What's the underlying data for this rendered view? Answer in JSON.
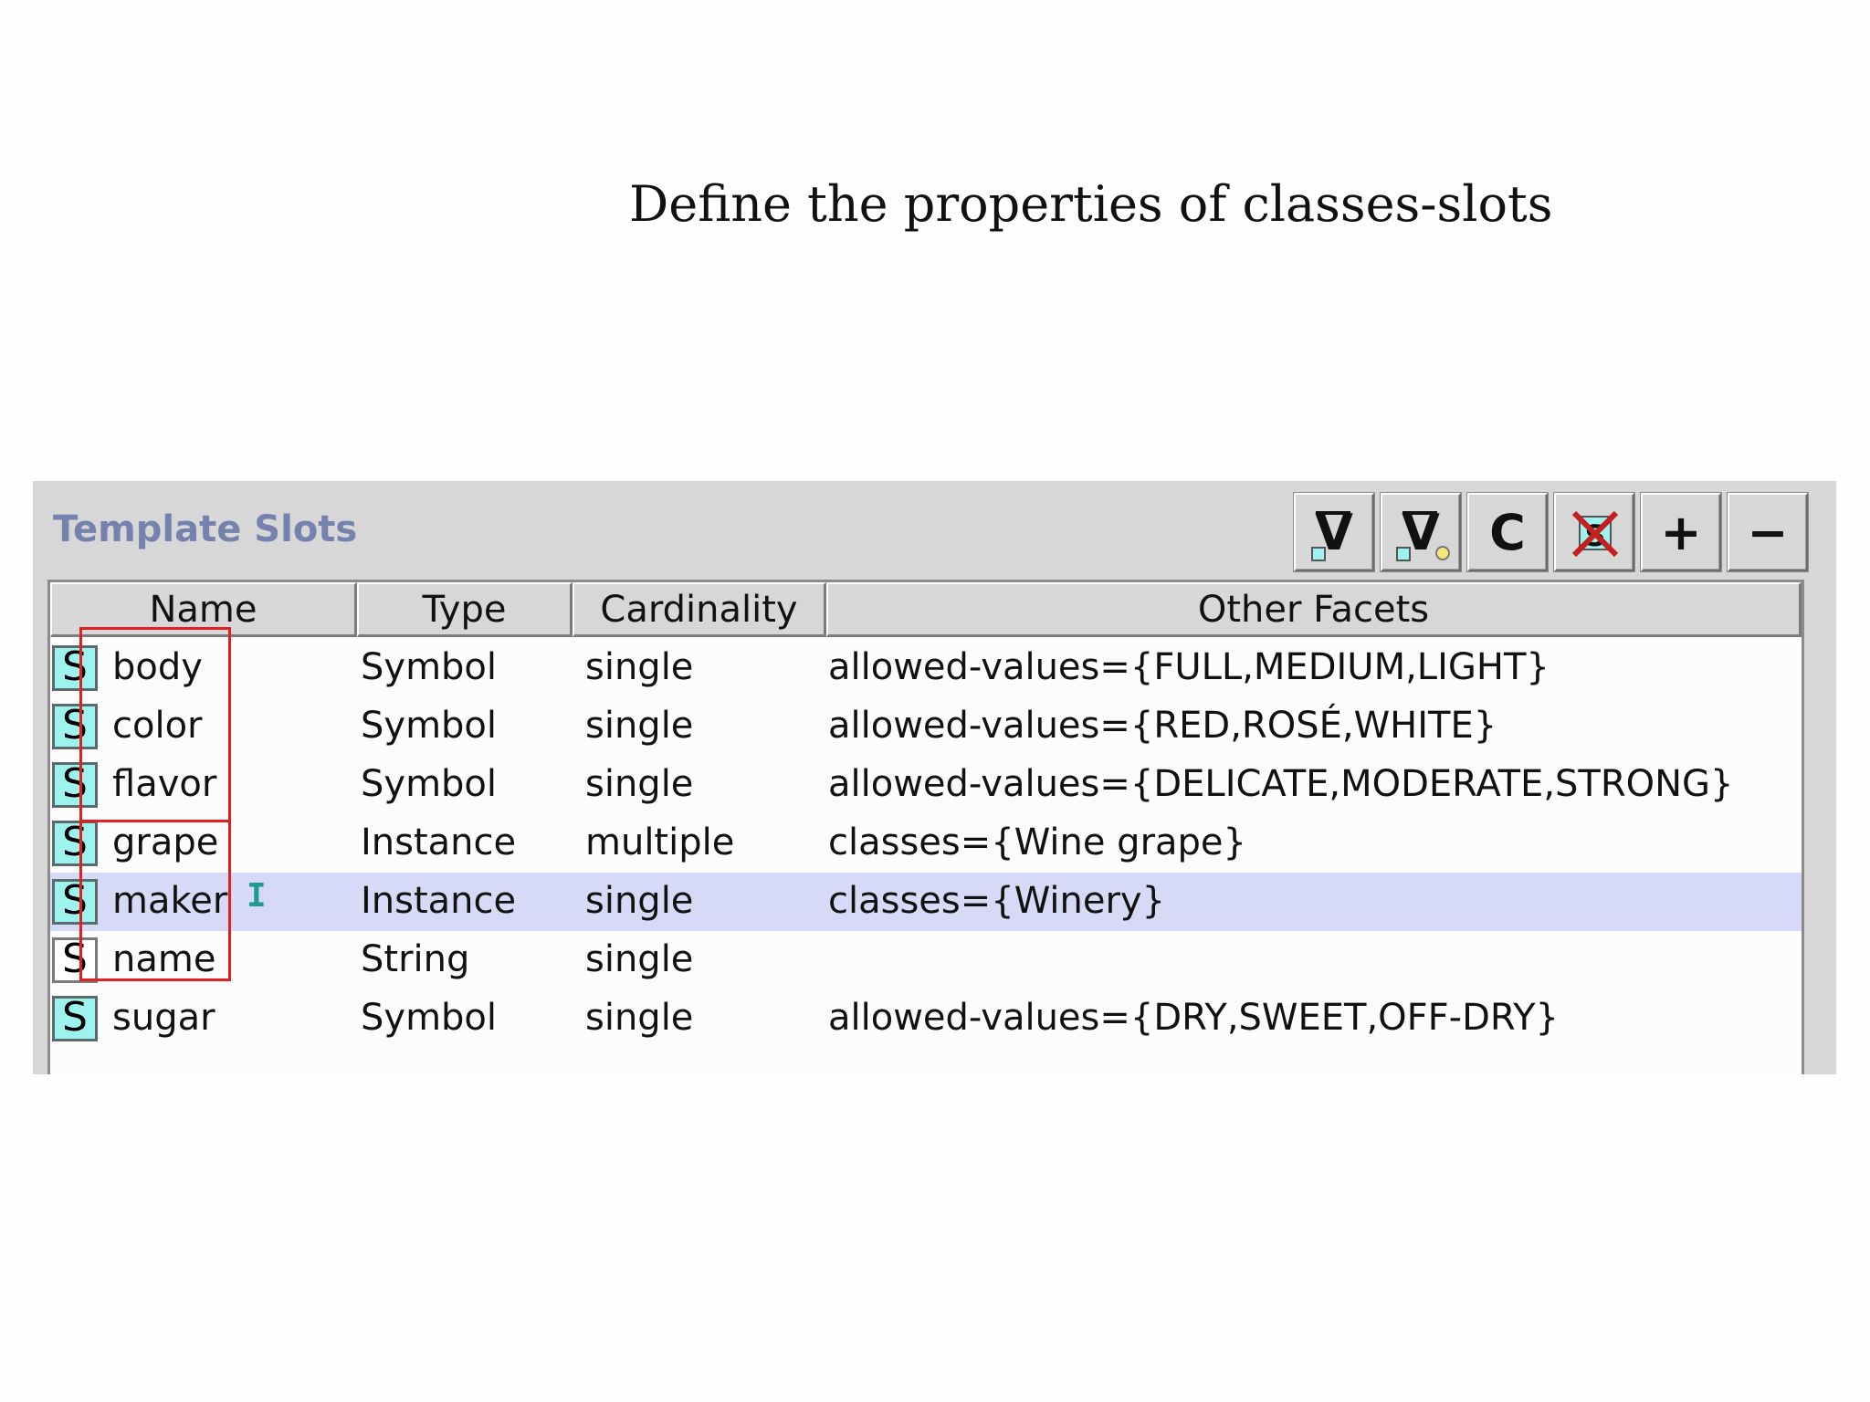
{
  "slide": {
    "title": "Define the properties of classes-slots"
  },
  "panel": {
    "title": "Template Slots",
    "toolbar": [
      {
        "name": "view-slot-button",
        "label": "V",
        "icon": "view-slot-icon"
      },
      {
        "name": "view-facet-button",
        "label": "V",
        "icon": "view-facet-icon"
      },
      {
        "name": "create-slot-button",
        "label": "C",
        "icon": "create-icon"
      },
      {
        "name": "remove-override-button",
        "label": "",
        "icon": "remove-override-icon"
      },
      {
        "name": "add-slot-button",
        "label": "+",
        "icon": "plus-icon"
      },
      {
        "name": "remove-slot-button",
        "label": "−",
        "icon": "minus-icon"
      }
    ]
  },
  "table": {
    "columns": [
      "Name",
      "Type",
      "Cardinality",
      "Other Facets"
    ],
    "rows": [
      {
        "icon": "S",
        "name": "body",
        "type": "Symbol",
        "cardinality": "single",
        "facets": "allowed-values={FULL,MEDIUM,LIGHT}",
        "selected": false,
        "inherited": true
      },
      {
        "icon": "S",
        "name": "color",
        "type": "Symbol",
        "cardinality": "single",
        "facets": "allowed-values={RED,ROSÉ,WHITE}",
        "selected": false,
        "inherited": true
      },
      {
        "icon": "S",
        "name": "flavor",
        "type": "Symbol",
        "cardinality": "single",
        "facets": "allowed-values={DELICATE,MODERATE,STRONG}",
        "selected": false,
        "inherited": true
      },
      {
        "icon": "S",
        "name": "grape",
        "type": "Instance",
        "cardinality": "multiple",
        "facets": "classes={Wine grape}",
        "selected": false,
        "inherited": true
      },
      {
        "icon": "S",
        "name": "maker",
        "type": "Instance",
        "cardinality": "single",
        "facets": "classes={Winery}",
        "selected": true,
        "inherited": true
      },
      {
        "icon": "S",
        "name": "name",
        "type": "String",
        "cardinality": "single",
        "facets": "",
        "selected": false,
        "inherited": false
      },
      {
        "icon": "S",
        "name": "sugar",
        "type": "Symbol",
        "cardinality": "single",
        "facets": "allowed-values={DRY,SWEET,OFF-DRY}",
        "selected": false,
        "inherited": true
      }
    ]
  },
  "colors": {
    "panel_title": "#7582ad",
    "selected_row": "#d6daf6",
    "slot_icon": "#9ff3ef",
    "highlight": "#e02020",
    "text_cursor": "#1e9c92"
  }
}
